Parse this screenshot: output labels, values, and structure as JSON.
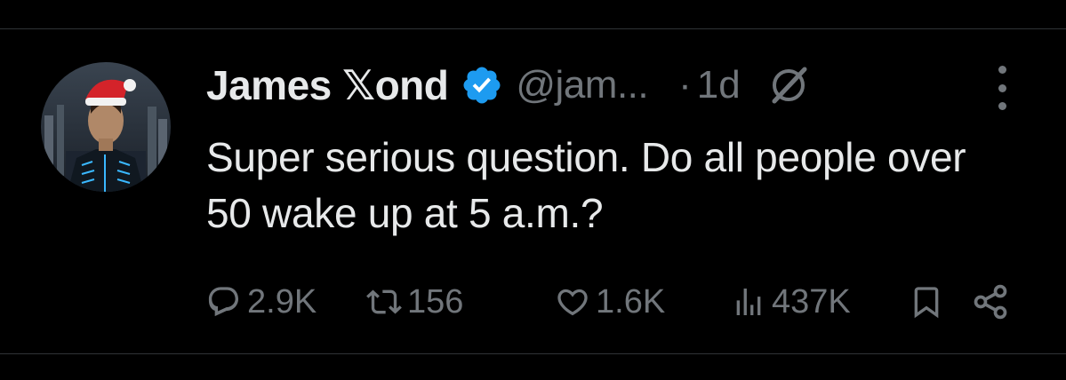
{
  "tweet": {
    "author_name": "James 𝕏ond",
    "handle": "@jam...",
    "separator": "·",
    "time": "1d",
    "text": "Super serious question. Do all people over 50 wake up at 5 a.m.?"
  },
  "actions": {
    "replies": "2.9K",
    "reposts": "156",
    "likes": "1.6K",
    "views": "437K"
  },
  "colors": {
    "background": "#000000",
    "text_primary": "#e7e9ea",
    "text_secondary": "#71767b",
    "verified_blue": "#1d9bf0",
    "divider": "#2f3336"
  },
  "icons": [
    "verified-badge-icon",
    "grok-icon",
    "more-icon",
    "reply-icon",
    "repost-icon",
    "like-icon",
    "views-icon",
    "bookmark-icon",
    "share-icon"
  ]
}
